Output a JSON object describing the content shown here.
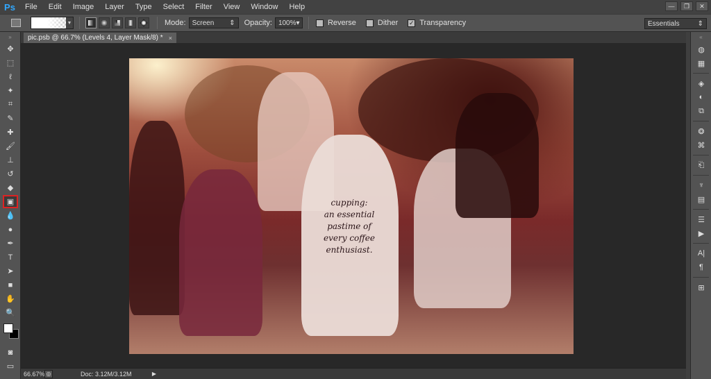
{
  "app": {
    "logo": "Ps"
  },
  "menu": [
    "File",
    "Edit",
    "Image",
    "Layer",
    "Type",
    "Select",
    "Filter",
    "View",
    "Window",
    "Help"
  ],
  "window_controls": [
    "—",
    "❐",
    "✕"
  ],
  "options": {
    "mode_label": "Mode:",
    "mode_value": "Screen",
    "opacity_label": "Opacity:",
    "opacity_value": "100%",
    "reverse_label": "Reverse",
    "dither_label": "Dither",
    "transparency_label": "Transparency",
    "reverse_checked": false,
    "dither_checked": false,
    "transparency_checked": true,
    "workspace": "Essentials"
  },
  "document": {
    "tab_title": "pic.psb @ 66.7% (Levels 4, Layer Mask/8) *",
    "close": "×",
    "shirt_lines": [
      "cupping:",
      "an essential",
      "pastime of",
      "every coffee",
      "enthusiast."
    ]
  },
  "status": {
    "zoom": "66.67%",
    "doc": "Doc: 3.12M/3.12M"
  },
  "tools": [
    "move-tool",
    "marquee-tool",
    "lasso-tool",
    "quick-select-tool",
    "crop-tool",
    "eyedropper-tool",
    "healing-brush-tool",
    "brush-tool",
    "clone-stamp-tool",
    "history-brush-tool",
    "eraser-tool",
    "gradient-tool",
    "blur-tool",
    "dodge-tool",
    "pen-tool",
    "type-tool",
    "path-select-tool",
    "shape-tool",
    "hand-tool",
    "zoom-tool"
  ],
  "colors": {
    "foreground": "#ffffff",
    "background": "#000000",
    "active_tool_border": "#dd2222"
  }
}
